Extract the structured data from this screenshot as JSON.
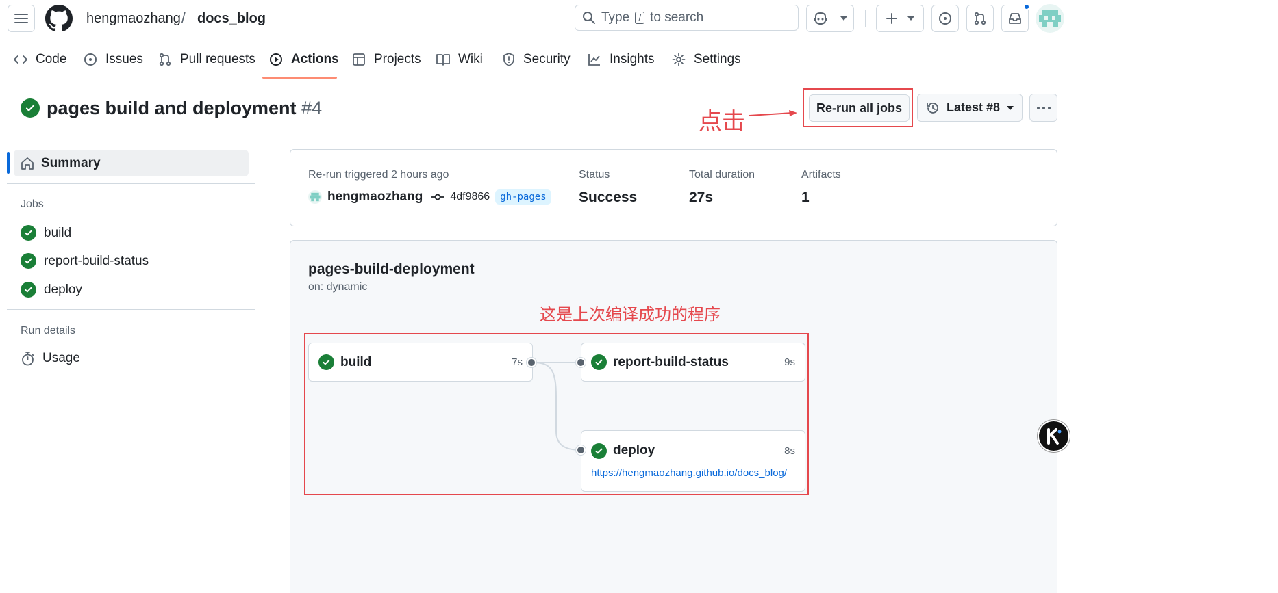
{
  "header": {
    "owner": "hengmaozhang",
    "separator": "/",
    "repo": "docs_blog",
    "search_prefix": "Type",
    "search_key": "/",
    "search_suffix": "to search"
  },
  "nav": {
    "tabs": [
      {
        "label": "Code"
      },
      {
        "label": "Issues"
      },
      {
        "label": "Pull requests"
      },
      {
        "label": "Actions"
      },
      {
        "label": "Projects"
      },
      {
        "label": "Wiki"
      },
      {
        "label": "Security"
      },
      {
        "label": "Insights"
      },
      {
        "label": "Settings"
      }
    ]
  },
  "run": {
    "title": "pages build and deployment",
    "number": "#4",
    "rerun_label": "Re-run all jobs",
    "latest_label": "Latest #8"
  },
  "annotations": {
    "click_note": "点击",
    "program_note": "这是上次编译成功的程序"
  },
  "sidebar": {
    "summary_label": "Summary",
    "jobs_heading": "Jobs",
    "jobs": [
      {
        "label": "build"
      },
      {
        "label": "report-build-status"
      },
      {
        "label": "deploy"
      }
    ],
    "run_details_heading": "Run details",
    "usage_label": "Usage"
  },
  "summary": {
    "trigger_text": "Re-run triggered 2 hours ago",
    "actor": "hengmaozhang",
    "commit": "4df9866",
    "branch": "gh-pages",
    "status_label": "Status",
    "status_value": "Success",
    "duration_label": "Total duration",
    "duration_value": "27s",
    "artifacts_label": "Artifacts",
    "artifacts_value": "1"
  },
  "workflow": {
    "name": "pages-build-deployment",
    "trigger": "on: dynamic",
    "jobs": {
      "build": {
        "name": "build",
        "duration": "7s"
      },
      "report": {
        "name": "report-build-status",
        "duration": "9s"
      },
      "deploy": {
        "name": "deploy",
        "duration": "8s",
        "url": "https://hengmaozhang.github.io/docs_blog/"
      }
    }
  },
  "colors": {
    "success": "#1a7f37",
    "accent_underline": "#fd8c73",
    "annotation_red": "#e5484d",
    "link": "#0969da"
  }
}
